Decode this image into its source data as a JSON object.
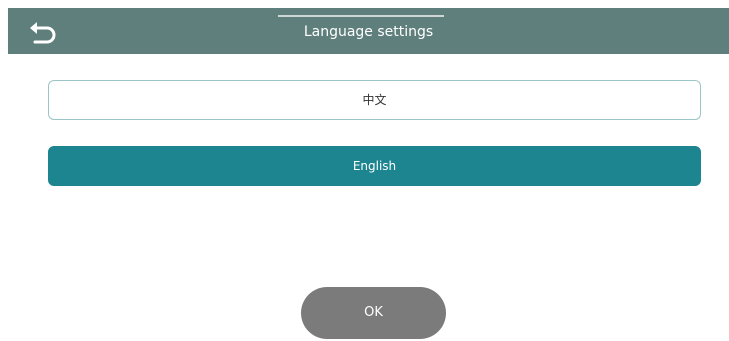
{
  "header": {
    "title": "Language settings",
    "back_icon": "undo-arrow-icon",
    "background_color": "#5f7f7d"
  },
  "languages": {
    "options": [
      {
        "label": "中文",
        "selected": false
      },
      {
        "label": "English",
        "selected": true
      }
    ],
    "selected_color": "#1d8590"
  },
  "actions": {
    "ok_label": "OK",
    "ok_color": "#7b7b7b"
  }
}
